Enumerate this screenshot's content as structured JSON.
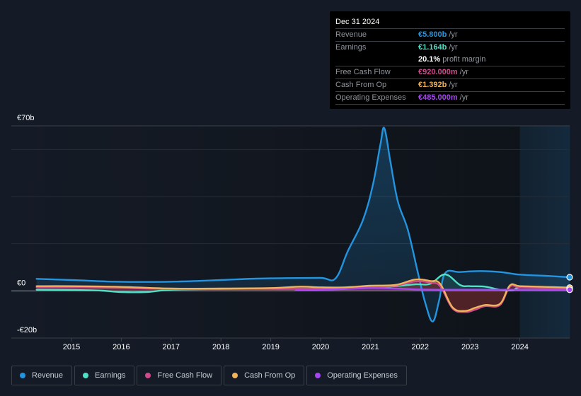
{
  "tooltip": {
    "date": "Dec 31 2024",
    "rows": [
      {
        "label": "Revenue",
        "value": "€5.800b",
        "unit": "/yr",
        "color": "#2394df"
      },
      {
        "label": "Earnings",
        "value": "€1.164b",
        "unit": "/yr",
        "color": "#4fe0c8"
      },
      {
        "label": "",
        "value": "20.1%",
        "unit": "profit margin",
        "color": "#ffffff"
      },
      {
        "label": "Free Cash Flow",
        "value": "€920.000m",
        "unit": "/yr",
        "color": "#cf4a8d"
      },
      {
        "label": "Cash From Op",
        "value": "€1.392b",
        "unit": "/yr",
        "color": "#f0b25a"
      },
      {
        "label": "Operating Expenses",
        "value": "€485.000m",
        "unit": "/yr",
        "color": "#a546f0"
      }
    ]
  },
  "legend": [
    {
      "label": "Revenue",
      "color": "#2394df"
    },
    {
      "label": "Earnings",
      "color": "#4fe0c8"
    },
    {
      "label": "Free Cash Flow",
      "color": "#cf4a8d"
    },
    {
      "label": "Cash From Op",
      "color": "#f0b25a"
    },
    {
      "label": "Operating Expenses",
      "color": "#a546f0"
    }
  ],
  "chart_data": {
    "type": "area",
    "title": "",
    "xlabel": "",
    "ylabel": "",
    "x_ticks": [
      "2015",
      "2016",
      "2017",
      "2018",
      "2019",
      "2020",
      "2021",
      "2022",
      "2023",
      "2024"
    ],
    "y_ticks": [
      {
        "value": 70,
        "label": "€70b"
      },
      {
        "value": 0,
        "label": "€0"
      },
      {
        "value": -20,
        "label": "-€20b"
      }
    ],
    "ylim": [
      -20,
      70
    ],
    "xlim": [
      2014.1,
      2025.0
    ],
    "forecast_start": 2024.0,
    "grid": true,
    "legend_position": "bottom",
    "series": [
      {
        "name": "Revenue",
        "color": "#2394df",
        "x": [
          2014.3,
          2015.0,
          2015.85,
          2016.5,
          2017.2,
          2018.0,
          2018.7,
          2019.3,
          2020.0,
          2020.3,
          2020.55,
          2020.85,
          2021.05,
          2021.2,
          2021.28,
          2021.4,
          2021.55,
          2021.75,
          2021.95,
          2022.1,
          2022.25,
          2022.38,
          2022.5,
          2022.8,
          2023.2,
          2023.6,
          2024.0,
          2024.5,
          2025.0
        ],
        "values": [
          5.1,
          4.6,
          3.9,
          3.8,
          4.0,
          4.6,
          5.2,
          5.4,
          5.5,
          5.3,
          17,
          30,
          45,
          62,
          69,
          55,
          38,
          26,
          8,
          -5,
          -13,
          -4,
          7.5,
          8.0,
          8.4,
          8.0,
          6.9,
          6.4,
          5.8
        ]
      },
      {
        "name": "Earnings",
        "color": "#4fe0c8",
        "x": [
          2014.3,
          2015.0,
          2015.6,
          2016.0,
          2016.5,
          2017.0,
          2018.0,
          2019.0,
          2020.0,
          2020.5,
          2021.0,
          2021.5,
          2021.9,
          2022.2,
          2022.5,
          2022.8,
          2023.0,
          2023.3,
          2023.6,
          2023.85,
          2024.0,
          2024.5,
          2025.0
        ],
        "values": [
          0.5,
          0.4,
          0.1,
          -0.5,
          -0.5,
          0.5,
          0.8,
          0.9,
          1.0,
          1.1,
          1.3,
          2.0,
          2.8,
          3.0,
          7.0,
          2.5,
          2.0,
          1.8,
          0.5,
          0.2,
          1.5,
          1.3,
          1.164
        ]
      },
      {
        "name": "Free Cash Flow",
        "color": "#cf4a8d",
        "x": [
          2014.3,
          2015.0,
          2016.0,
          2017.0,
          2018.0,
          2019.0,
          2019.6,
          2020.0,
          2020.5,
          2021.0,
          2021.5,
          2021.9,
          2022.2,
          2022.4,
          2022.65,
          2022.9,
          2023.1,
          2023.3,
          2023.6,
          2023.8,
          2024.0,
          2024.5,
          2025.0
        ],
        "values": [
          1.5,
          1.5,
          1.2,
          0.8,
          0.8,
          1.0,
          1.0,
          0.8,
          1.0,
          1.6,
          2.2,
          4.0,
          3.5,
          2.0,
          -7.5,
          -9.0,
          -8.0,
          -6.5,
          -6.0,
          1.8,
          1.5,
          1.2,
          0.92
        ]
      },
      {
        "name": "Cash From Op",
        "color": "#f0b25a",
        "x": [
          2014.3,
          2015.0,
          2016.0,
          2017.0,
          2018.0,
          2019.0,
          2019.6,
          2020.0,
          2020.5,
          2021.0,
          2021.5,
          2021.9,
          2022.2,
          2022.4,
          2022.65,
          2022.9,
          2023.1,
          2023.3,
          2023.6,
          2023.8,
          2024.0,
          2024.5,
          2025.0
        ],
        "values": [
          2.0,
          2.0,
          1.7,
          1.0,
          1.0,
          1.2,
          1.8,
          1.5,
          1.5,
          2.2,
          2.5,
          4.8,
          4.2,
          3.0,
          -7.0,
          -8.5,
          -7.2,
          -6.0,
          -5.5,
          2.3,
          2.0,
          1.7,
          1.392
        ]
      },
      {
        "name": "Operating Expenses",
        "color": "#a546f0",
        "x": [
          2019.5,
          2020.0,
          2020.5,
          2021.0,
          2021.5,
          2022.0,
          2022.5,
          2023.0,
          2023.5,
          2024.0,
          2024.5,
          2025.0
        ],
        "values": [
          0.4,
          0.5,
          0.8,
          1.2,
          1.0,
          0.6,
          0.5,
          0.5,
          0.5,
          0.5,
          0.5,
          0.485
        ]
      }
    ]
  }
}
